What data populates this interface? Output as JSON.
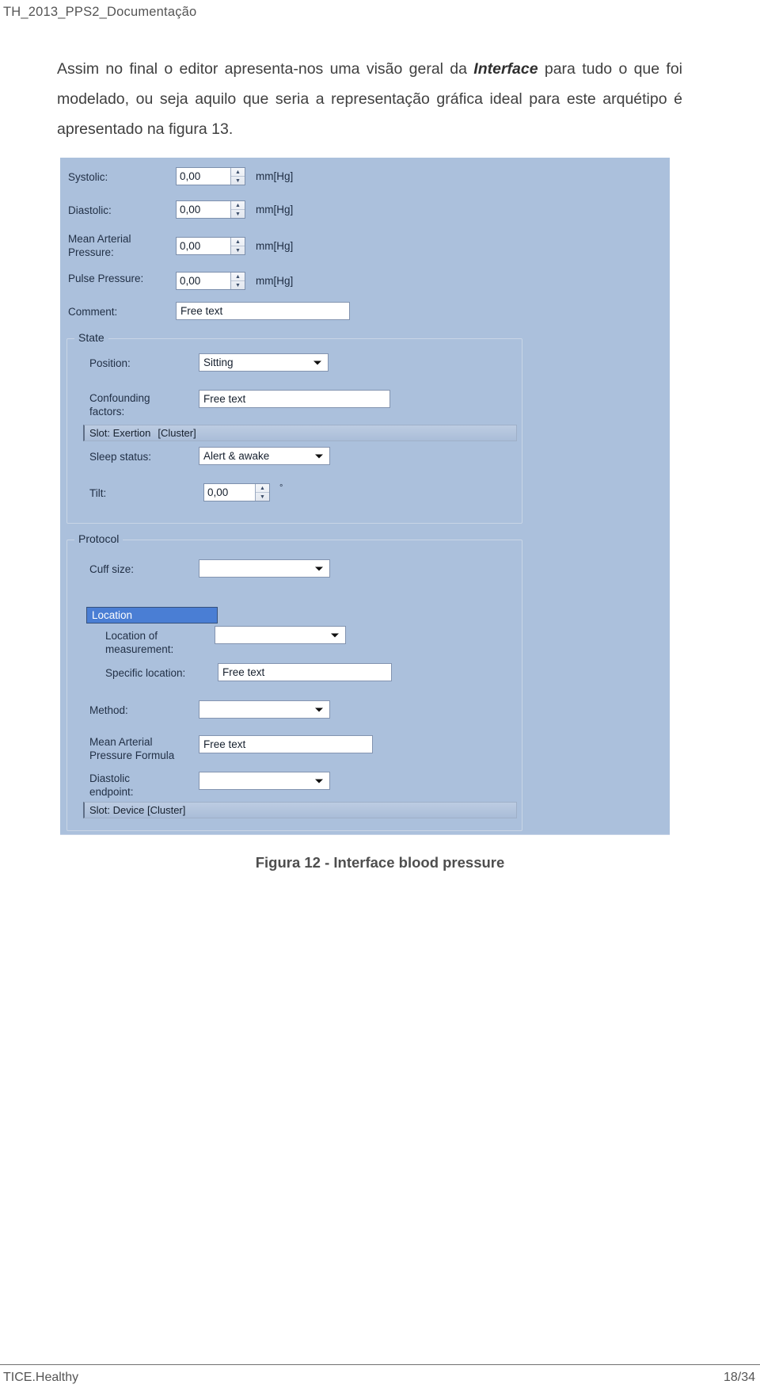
{
  "document": {
    "header": "TH_2013_PPS2_Documentação",
    "paragraph_parts": {
      "before": "Assim no final o editor apresenta-nos uma visão geral da ",
      "emphasis": "Interface",
      "after": " para tudo o que foi modelado, ou seja aquilo que seria a representação gráfica ideal para este arquétipo é apresentado na figura 13."
    },
    "caption": "Figura 12 - Interface blood pressure",
    "footer": {
      "left": "TICE.Healthy",
      "page": "18/34"
    }
  },
  "figure": {
    "background_color": "#abc0dc",
    "selected_color": "#4a7ed4",
    "fields": {
      "systolic": {
        "label": "Systolic:",
        "value": "0,00",
        "unit": "mm[Hg]"
      },
      "diastolic": {
        "label": "Diastolic:",
        "value": "0,00",
        "unit": "mm[Hg]"
      },
      "mean_arterial_pressure": {
        "label": "Mean Arterial\nPressure:",
        "value": "0,00",
        "unit": "mm[Hg]"
      },
      "pulse_pressure": {
        "label": "Pulse Pressure:",
        "value": "0,00",
        "unit": "mm[Hg]"
      },
      "comment": {
        "label": "Comment:",
        "value": "Free text"
      }
    },
    "state_group": {
      "title": "State",
      "position": {
        "label": "Position:",
        "value": "Sitting"
      },
      "confounding_factors": {
        "label": "Confounding\nfactors:",
        "value": "Free text"
      },
      "slot_exertion": {
        "name": "Slot: Exertion",
        "kind": "[Cluster]"
      },
      "sleep_status": {
        "label": "Sleep status:",
        "value": "Alert & awake"
      },
      "tilt": {
        "label": "Tilt:",
        "value": "0,00",
        "unit": "°"
      }
    },
    "protocol_group": {
      "title": "Protocol",
      "cuff_size": {
        "label": "Cuff size:",
        "value": ""
      },
      "location_header": "Location",
      "location_of_measurement": {
        "label": "Location of\nmeasurement:",
        "value": ""
      },
      "specific_location": {
        "label": "Specific location:",
        "value": "Free text"
      },
      "method": {
        "label": "Method:",
        "value": ""
      },
      "map_formula": {
        "label": "Mean Arterial\nPressure Formula",
        "value": "Free text"
      },
      "diastolic_endpoint": {
        "label": "Diastolic\nendpoint:",
        "value": ""
      },
      "slot_device": {
        "name": "Slot: Device [Cluster]"
      }
    }
  }
}
